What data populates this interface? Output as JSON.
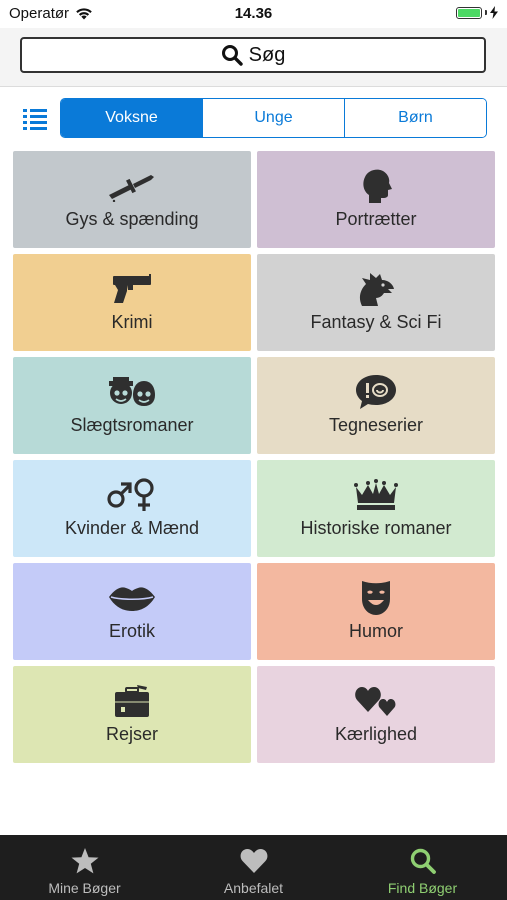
{
  "status_bar": {
    "carrier": "Operatør",
    "time": "14.36"
  },
  "search": {
    "label": "Søg"
  },
  "segments": [
    {
      "label": "Voksne",
      "active": true
    },
    {
      "label": "Unge",
      "active": false
    },
    {
      "label": "Børn",
      "active": false
    }
  ],
  "categories": [
    {
      "label": "Gys & spænding",
      "icon": "knife-icon",
      "color": "#c2c8cc"
    },
    {
      "label": "Portrætter",
      "icon": "head-silhouette-icon",
      "color": "#cfbfd3"
    },
    {
      "label": "Krimi",
      "icon": "pistol-icon",
      "color": "#f1cf91"
    },
    {
      "label": "Fantasy & Sci Fi",
      "icon": "dragon-icon",
      "color": "#d2d2d2"
    },
    {
      "label": "Slægtsromaner",
      "icon": "family-icon",
      "color": "#b7dad7"
    },
    {
      "label": "Tegneserier",
      "icon": "speech-bubble-icon",
      "color": "#e6dcc6"
    },
    {
      "label": "Kvinder & Mænd",
      "icon": "gender-symbols-icon",
      "color": "#cce7f8"
    },
    {
      "label": "Historiske romaner",
      "icon": "crown-icon",
      "color": "#d2ead0"
    },
    {
      "label": "Erotik",
      "icon": "lips-icon",
      "color": "#c4cbf8"
    },
    {
      "label": "Humor",
      "icon": "mask-icon",
      "color": "#f3b8a0"
    },
    {
      "label": "Rejser",
      "icon": "suitcase-icon",
      "color": "#dde6b3"
    },
    {
      "label": "Kærlighed",
      "icon": "hearts-icon",
      "color": "#e8d3df"
    }
  ],
  "tabbar": [
    {
      "label": "Mine Bøger",
      "icon": "star-icon",
      "active": false
    },
    {
      "label": "Anbefalet",
      "icon": "heart-icon",
      "active": false
    },
    {
      "label": "Find Bøger",
      "icon": "search-icon",
      "active": true
    }
  ],
  "colors": {
    "accent": "#0a7ad8",
    "tab_active": "#8fcf72",
    "tabbar_bg": "#1e1e1e"
  }
}
